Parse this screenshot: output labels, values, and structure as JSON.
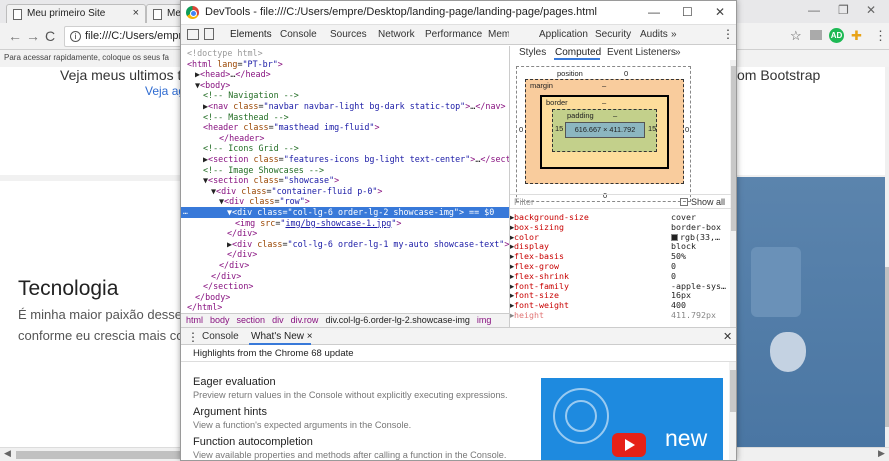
{
  "browser": {
    "tabs": [
      {
        "label": "Meu primeiro Site",
        "close": "×"
      },
      {
        "label": "Me",
        "close": ""
      }
    ],
    "window_controls": {
      "minimize": "—",
      "restore": "❐",
      "close": "✕"
    },
    "address": "file:///C:/Users/empre",
    "bookmarks_hint": "Para acessar rapidamente, coloque os seus fa",
    "nav": {
      "back": "←",
      "forward": "→",
      "reload": "C"
    }
  },
  "page": {
    "heading_left": "Veja meus ultimos tra",
    "heading_right": "om Bootstrap",
    "link_text": "Veja ag",
    "tech_title": "Tecnologia",
    "tech_line1": "É minha maior paixão desse",
    "tech_line2": "conforme eu crescia mais co"
  },
  "devtools": {
    "title": "DevTools - file:///C:/Users/empre/Desktop/landing-page/landing-page/pages.html",
    "window_controls": {
      "minimize": "—",
      "maximize": "☐",
      "close": "✕"
    },
    "tabs": [
      "Elements",
      "Console",
      "Sources",
      "Network",
      "Performance",
      "Memory"
    ],
    "more_tabs": "»",
    "side_tabs": [
      "Application",
      "Security",
      "Audits",
      "»"
    ],
    "menu": "⋮",
    "dom_lines": [
      {
        "indent": 0,
        "html": "<span class='tx' style='color:#999'>&lt;!doctype html&gt;</span>"
      },
      {
        "indent": 0,
        "html": "<span class='tg'>&lt;html</span> <span class='at'>lang</span>=<span class='av'>\"PT-br\"</span><span class='tg'>&gt;</span>"
      },
      {
        "indent": 1,
        "html": "▶<span class='tg'>&lt;head&gt;</span>…<span class='tg'>&lt;/head&gt;</span>"
      },
      {
        "indent": 1,
        "html": "▼<span class='tg'>&lt;body&gt;</span>"
      },
      {
        "indent": 2,
        "html": "<span class='cm'>&lt;!-- Navigation --&gt;</span>"
      },
      {
        "indent": 2,
        "html": "▶<span class='tg'>&lt;nav</span> <span class='at'>class</span>=<span class='av'>\"navbar navbar-light bg-dark static-top\"</span><span class='tg'>&gt;</span>…<span class='tg'>&lt;/nav&gt;</span>"
      },
      {
        "indent": 2,
        "html": "<span class='cm'>&lt;!-- Masthead --&gt;</span>"
      },
      {
        "indent": 2,
        "html": "<span class='tg'>&lt;header</span> <span class='at'>class</span>=<span class='av'>\"masthead img-fluid\"</span><span class='tg'>&gt;</span>"
      },
      {
        "indent": 4,
        "html": "<span class='tg'>&lt;/header&gt;</span>"
      },
      {
        "indent": 2,
        "html": "<span class='cm'>&lt;!-- Icons Grid --&gt;</span>"
      },
      {
        "indent": 2,
        "html": "▶<span class='tg'>&lt;section</span> <span class='at'>class</span>=<span class='av'>\"features-icons bg-light text-center\"</span><span class='tg'>&gt;</span>…<span class='tg'>&lt;/section&gt;</span>"
      },
      {
        "indent": 2,
        "html": "<span class='cm'>&lt;!-- Image Showcases --&gt;</span>"
      },
      {
        "indent": 2,
        "html": "▼<span class='tg'>&lt;section</span> <span class='at'>class</span>=<span class='av'>\"showcase\"</span><span class='tg'>&gt;</span>"
      },
      {
        "indent": 3,
        "html": "▼<span class='tg'>&lt;div</span> <span class='at'>class</span>=<span class='av'>\"container-fluid p-0\"</span><span class='tg'>&gt;</span>"
      },
      {
        "indent": 4,
        "html": "▼<span class='tg'>&lt;div</span> <span class='at'>class</span>=<span class='av'>\"row\"</span><span class='tg'>&gt;</span>"
      },
      {
        "indent": 5,
        "html": "▼<span class='tg'>&lt;div</span> <span class='at'>class</span>=<span class='av'>\"col-lg-6 order-lg-2 showcase-img\"</span><span class='tg'>&gt;</span> == $0",
        "selected": true
      },
      {
        "indent": 6,
        "html": "<span class='tg'>&lt;img</span> <span class='at'>src</span>=<span class='av'>\"<span class='lnk'>img/bg-showcase-1.jpg</span>\"</span><span class='tg'>&gt;</span>"
      },
      {
        "indent": 5,
        "html": "<span class='tg'>&lt;/div&gt;</span>"
      },
      {
        "indent": 5,
        "html": "▶<span class='tg'>&lt;div</span> <span class='at'>class</span>=<span class='av'>\"col-lg-6 order-lg-1 my-auto showcase-text\"</span><span class='tg'>&gt;</span>…"
      },
      {
        "indent": 5,
        "html": "<span class='tg'>&lt;/div&gt;</span>"
      },
      {
        "indent": 4,
        "html": "<span class='tg'>&lt;/div&gt;</span>"
      },
      {
        "indent": 3,
        "html": "<span class='tg'>&lt;/div&gt;</span>"
      },
      {
        "indent": 2,
        "html": "<span class='tg'>&lt;/section&gt;</span>"
      },
      {
        "indent": 1,
        "html": "<span class='tg'>&lt;/body&gt;</span>"
      },
      {
        "indent": 0,
        "html": "<span class='tg'>&lt;/html&gt;</span>"
      }
    ],
    "dom_dots": "…",
    "breadcrumbs": [
      "html",
      "body",
      "section",
      "div",
      "div.row",
      "div.col-lg-6.order-lg-2.showcase-img",
      "img"
    ],
    "breadcrumb_active_index": 5,
    "styles_tabs": [
      "Styles",
      "Computed",
      "Event Listeners",
      "»"
    ],
    "box_model": {
      "position_label": "position",
      "position_value": "0",
      "margin_label": "margin",
      "margin_value": "–",
      "border_label": "border",
      "border_value": "–",
      "padding_label": "padding",
      "padding_value": "–",
      "content": "616.667 × 411.792",
      "padding_left": "15",
      "padding_right": "15",
      "border_dash": "–",
      "left_outer": "0",
      "right_outer": "0",
      "bottom_outer": "0"
    },
    "filter_placeholder": "Filter",
    "show_all": "Show all",
    "computed": [
      {
        "name": "background-size",
        "value": "cover"
      },
      {
        "name": "box-sizing",
        "value": "border-box"
      },
      {
        "name": "color",
        "value": "rgb(33,…",
        "swatch": "#212121"
      },
      {
        "name": "display",
        "value": "block"
      },
      {
        "name": "flex-basis",
        "value": "50%"
      },
      {
        "name": "flex-grow",
        "value": "0"
      },
      {
        "name": "flex-shrink",
        "value": "0"
      },
      {
        "name": "font-family",
        "value": "-apple-sys…"
      },
      {
        "name": "font-size",
        "value": "16px"
      },
      {
        "name": "font-weight",
        "value": "400"
      },
      {
        "name": "height",
        "value": "411.792px"
      }
    ],
    "drawer": {
      "tabs": [
        "Console",
        "What's New ×"
      ],
      "menu": "⋮",
      "close": "✕",
      "header": "Highlights from the Chrome 68 update",
      "features": [
        {
          "title": "Eager evaluation",
          "desc": "Preview return values in the Console without explicitly executing expressions."
        },
        {
          "title": "Argument hints",
          "desc": "View a function's expected arguments in the Console."
        },
        {
          "title": "Function autocompletion",
          "desc": "View available properties and methods after calling a function in the Console."
        }
      ],
      "promo_text": "new"
    }
  }
}
